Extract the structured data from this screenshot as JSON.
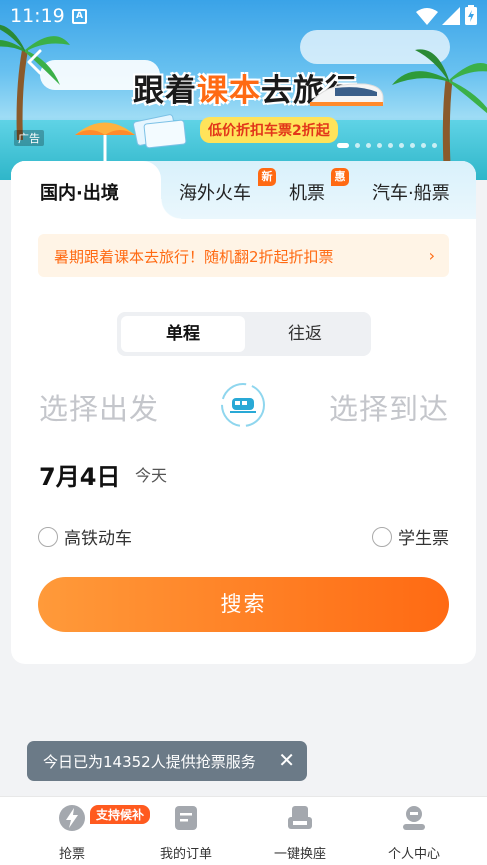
{
  "status_bar": {
    "time": "11:19",
    "notification_icon": "a-icon"
  },
  "banner": {
    "title_prefix": "跟着",
    "title_highlight": "课本",
    "title_suffix": "去旅行",
    "subtitle": "低价折扣车票2折起",
    "ad_tag": "广告",
    "back_icon": "chevron-left-icon",
    "carousel_count": 9,
    "carousel_active": 0
  },
  "tabs": [
    {
      "label": "国内·出境",
      "active": true
    },
    {
      "label": "海外火车",
      "badge": "新"
    },
    {
      "label": "机票",
      "badge": "惠"
    },
    {
      "label": "汽车·船票"
    }
  ],
  "notice": {
    "text": "暑期跟着课本去旅行！随机翻2折起折扣票",
    "chevron": "›"
  },
  "trip_type": {
    "one_way": "单程",
    "round_trip": "往返",
    "selected": "单程"
  },
  "route": {
    "from_placeholder": "选择出发",
    "to_placeholder": "选择到达",
    "swap_icon": "train-swap-icon"
  },
  "date": {
    "value": "7月4日",
    "sub": "今天"
  },
  "options": [
    {
      "label": "高铁动车",
      "checked": false
    },
    {
      "label": "学生票",
      "checked": false
    }
  ],
  "search_label": "搜索",
  "toast": {
    "text": "今日已为14352人提供抢票服务",
    "close": "✕"
  },
  "bottom_nav": {
    "items": [
      {
        "label": "抢票",
        "icon": "lightning-icon"
      },
      {
        "label": "我的订单",
        "icon": "order-icon"
      },
      {
        "label": "一键换座",
        "icon": "seat-icon"
      },
      {
        "label": "个人中心",
        "icon": "person-icon"
      }
    ],
    "badge": "支持候补"
  },
  "colors": {
    "accent": "#ff6a13",
    "tab_bg": "#d9f1fb",
    "notice_bg": "#fff4e6"
  }
}
